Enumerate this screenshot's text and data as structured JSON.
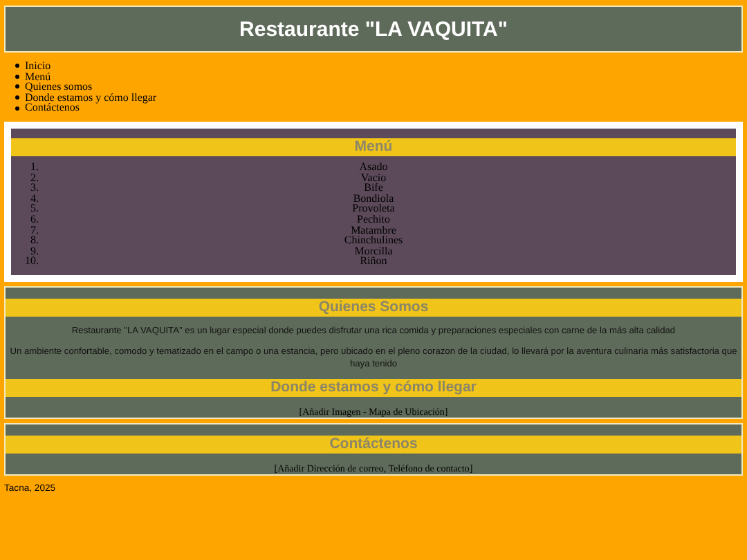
{
  "header": {
    "title": "Restaurante \"LA VAQUITA\""
  },
  "nav": {
    "items": [
      "Inicio",
      "Menú",
      "Quienes somos",
      "Donde estamos y cómo llegar",
      "Contáctenos"
    ]
  },
  "menu": {
    "heading": "Menú",
    "items": [
      {
        "number": "1.",
        "name": "Asado"
      },
      {
        "number": "2.",
        "name": "Vacio"
      },
      {
        "number": "3.",
        "name": "Bife"
      },
      {
        "number": "4.",
        "name": "Bondiola"
      },
      {
        "number": "5.",
        "name": "Provoleta"
      },
      {
        "number": "6.",
        "name": "Pechito"
      },
      {
        "number": "7.",
        "name": "Matambre"
      },
      {
        "number": "8.",
        "name": "Chinchulines"
      },
      {
        "number": "9.",
        "name": "Morcilla"
      },
      {
        "number": "10.",
        "name": "Riñon"
      }
    ]
  },
  "about": {
    "heading": "Quienes Somos",
    "paragraphs": [
      "Restaurante \"LA VAQUITA\" es un lugar especial donde puedes disfrutar una rica comida y preparaciones especiales con carne de la más alta calidad",
      "Un ambiente confortable, comodo y tematizado en el campo o una estancia, pero ubicado en el pleno corazon de la ciudad, lo llevará por la aventura culinaria más satisfactoria que haya tenido"
    ]
  },
  "location": {
    "heading": "Donde estamos y cómo llegar",
    "placeholder_text": "[Añadir Imagen - Mapa de Ubicación]"
  },
  "contact": {
    "heading": "Contáctenos",
    "placeholder_text": "[Añadir Dirección de correo, Teléfono de contacto]"
  },
  "footer": {
    "text": "Tacna, 2025"
  }
}
